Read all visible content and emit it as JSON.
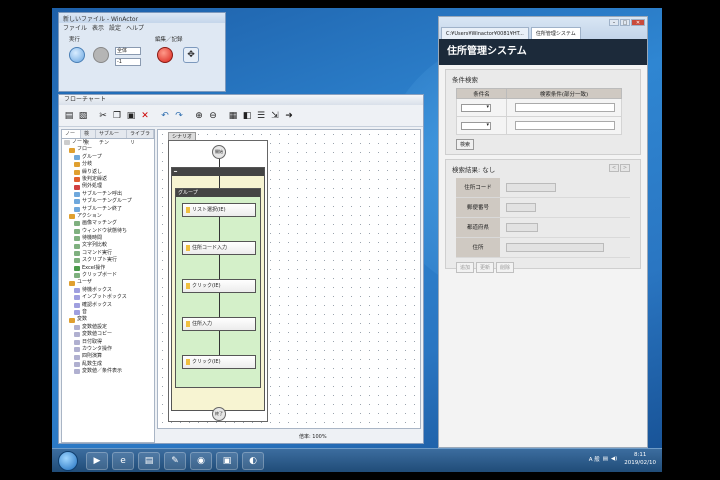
{
  "winactor": {
    "title": "新しいファイル - WinActor",
    "menu": [
      "ファイル",
      "表示",
      "設定",
      "ヘルプ"
    ],
    "group_run_label": "実行",
    "group_edit_label": "編集／記録",
    "speed_select": "全体",
    "count_select": "-1"
  },
  "flowchart": {
    "title": "フローチャート",
    "tabs": [
      "ノード",
      "検索",
      "サブルーチン",
      "ライブラリ"
    ],
    "tree": [
      {
        "label": "ノード",
        "color": "#cccccc"
      },
      {
        "label": "フロー",
        "color": "#e0a030"
      },
      {
        "label": "グループ",
        "color": "#6fa8dc"
      },
      {
        "label": "分岐",
        "color": "#e0a030"
      },
      {
        "label": "繰り返し",
        "color": "#e0a030"
      },
      {
        "label": "後判定繰返",
        "color": "#e06030"
      },
      {
        "label": "例外処理",
        "color": "#d04040"
      },
      {
        "label": "サブルーチン呼出",
        "color": "#6fa8dc"
      },
      {
        "label": "サブルーチングループ",
        "color": "#6fa8dc"
      },
      {
        "label": "サブルーチン終了",
        "color": "#6fa8dc"
      },
      {
        "label": "アクション",
        "color": "#e0a030"
      },
      {
        "label": "画像マッチング",
        "color": "#7fb07f"
      },
      {
        "label": "ウィンドウ状態待ち",
        "color": "#7fb07f"
      },
      {
        "label": "待機時間",
        "color": "#7fb07f"
      },
      {
        "label": "文字列比較",
        "color": "#7fb07f"
      },
      {
        "label": "コマンド実行",
        "color": "#7fb07f"
      },
      {
        "label": "スクリプト実行",
        "color": "#7fb07f"
      },
      {
        "label": "Excel操作",
        "color": "#4a9a4a"
      },
      {
        "label": "クリップボード",
        "color": "#7fb07f"
      },
      {
        "label": "ユーザ",
        "color": "#e0a030"
      },
      {
        "label": "待機ボックス",
        "color": "#9f9fdf"
      },
      {
        "label": "インプットボックス",
        "color": "#9f9fdf"
      },
      {
        "label": "確認ボックス",
        "color": "#9f9fdf"
      },
      {
        "label": "音",
        "color": "#9f9fdf"
      },
      {
        "label": "変数",
        "color": "#e0a030"
      },
      {
        "label": "変数値設定",
        "color": "#b0b0d0"
      },
      {
        "label": "変数値コピー",
        "color": "#b0b0d0"
      },
      {
        "label": "日付取得",
        "color": "#b0b0d0"
      },
      {
        "label": "カウンタ操作",
        "color": "#b0b0d0"
      },
      {
        "label": "四則演算",
        "color": "#b0b0d0"
      },
      {
        "label": "乱数生成",
        "color": "#b0b0d0"
      },
      {
        "label": "変数値／条件表示",
        "color": "#b0b0d0"
      }
    ],
    "scenario_label": "シナリオ",
    "start_label": "開始",
    "end_label": "終了",
    "group_label": "グループ",
    "steps": [
      "リスト選択(IE)",
      "住所コード入力",
      "クリック(IE)",
      "住所入力",
      "クリック(IE)"
    ],
    "zoom": "倍率: 100%"
  },
  "browser": {
    "tabs": [
      "C:¥Users¥Winactor¥0081¥HT...",
      "住所管理システム"
    ],
    "app_title": "住所管理システム",
    "search_title": "条件検索",
    "col_name": "条件名",
    "col_condition": "検索条件(部分一致)",
    "search_button": "検索",
    "results_title": "検索結果: なし",
    "fields": [
      "住所コード",
      "郵便番号",
      "都道府県",
      "住所"
    ],
    "buttons": [
      "追加",
      "更新",
      "削除"
    ],
    "pager": [
      "<",
      ">"
    ]
  },
  "taskbar": {
    "apps": [
      "▶",
      "e",
      "▤",
      "✎",
      "◉",
      "▣",
      "◐"
    ],
    "tray_lang": "A 般",
    "time": "8:11",
    "date": "2019/02/10"
  }
}
